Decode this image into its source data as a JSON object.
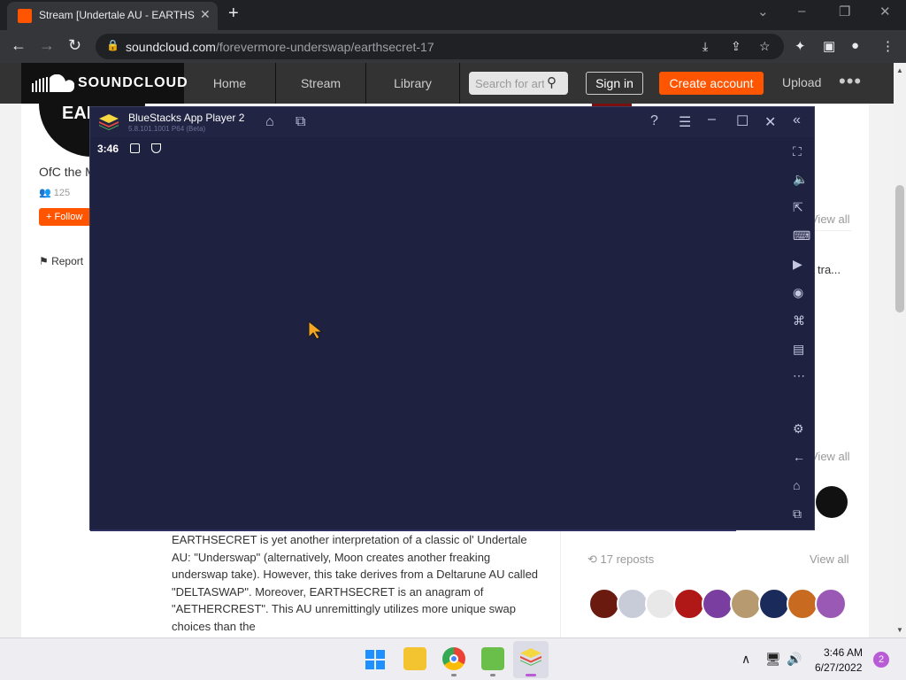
{
  "browser": {
    "tab_title": "Stream [Undertale AU - EARTHSECRET]",
    "url_host": "soundcloud.com",
    "url_path": "/forevermore-underswap/earthsecret-17"
  },
  "soundcloud": {
    "logo_text": "SOUNDCLOUD",
    "nav": [
      "Home",
      "Stream",
      "Library"
    ],
    "search_placeholder": "Search for artists",
    "signin_label": "Sign in",
    "create_label": "Create account",
    "upload_label": "Upload",
    "more_label": "•••"
  },
  "profile": {
    "avatar_text": "EARTHSECRET",
    "name": "OfC the M",
    "followers": "125",
    "follow_label": "Follow",
    "report_label": "Report"
  },
  "sidebar": {
    "view_all_1": "View all",
    "track_trunc": "tra...",
    "view_all_2": "View all",
    "reposts_label": "17 reposts",
    "view_all_reposts": "View all"
  },
  "description": "EARTHSECRET is yet another interpretation of a classic ol' Undertale AU: \"Underswap\" (alternatively, Moon creates another freaking underswap take). However, this take derives from a Deltarune AU called \"DELTASWAP\". Moreover, EARTHSECRET is an anagram of \"AETHERCREST\". This AU unremittingly utilizes more unique swap choices than the",
  "bluestacks": {
    "title": "BlueStacks App Player 2",
    "version": "5.8.101.1001 P64 (Beta)",
    "time": "3:46"
  },
  "taskbar": {
    "clock_time": "3:46 AM",
    "clock_date": "6/27/2022",
    "notification_count": "2"
  },
  "colors": {
    "soundcloud_orange": "#ff5500",
    "bluestacks_bg": "#1f2140",
    "cursor": "#f5a623"
  }
}
